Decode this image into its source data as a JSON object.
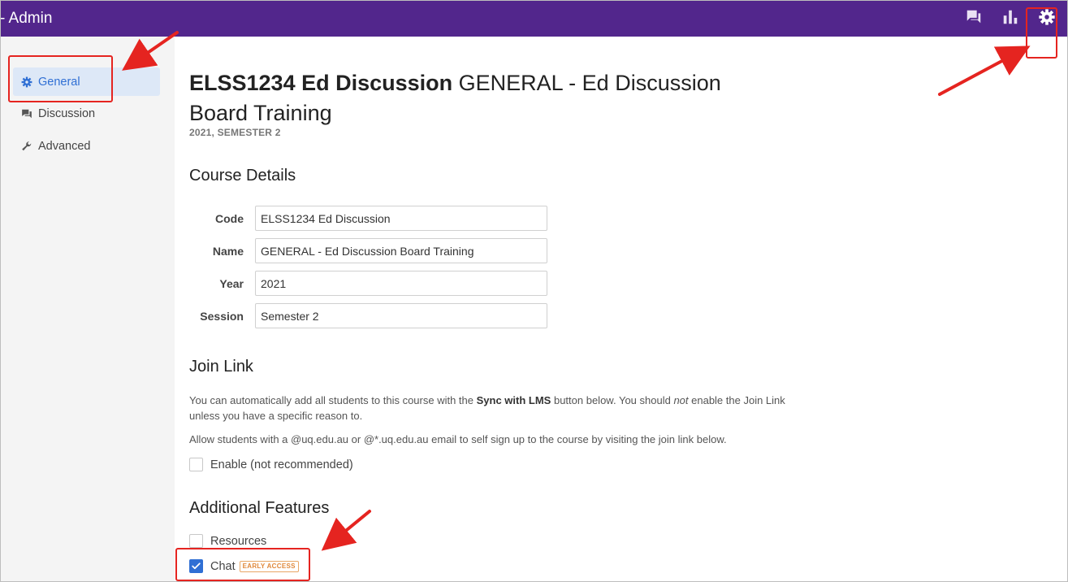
{
  "header": {
    "title": "- Admin",
    "icons": [
      "chat-icon",
      "bar-chart-icon",
      "gear-icon"
    ],
    "bg_color": "#52268c"
  },
  "sidebar": {
    "items": [
      {
        "label": "General",
        "icon": "gear-icon",
        "active": true
      },
      {
        "label": "Discussion",
        "icon": "chat-icon",
        "active": false
      },
      {
        "label": "Advanced",
        "icon": "wrench-icon",
        "active": false
      }
    ]
  },
  "course": {
    "code_bold": "ELSS1234 Ed Discussion",
    "name_rest": " GENERAL - Ed Discussion Board Training",
    "subtitle": "2021, SEMESTER 2"
  },
  "course_details": {
    "heading": "Course Details",
    "fields": [
      {
        "label": "Code",
        "value": "ELSS1234 Ed Discussion"
      },
      {
        "label": "Name",
        "value": "GENERAL - Ed Discussion Board Training"
      },
      {
        "label": "Year",
        "value": "2021"
      },
      {
        "label": "Session",
        "value": "Semester 2"
      }
    ]
  },
  "join_link": {
    "heading": "Join Link",
    "para1_a": "You can automatically add all students to this course with the ",
    "para1_b": "Sync with LMS",
    "para1_c": " button below. You should ",
    "para1_d": "not",
    "para1_e": " enable the Join Link unless you have a specific reason to.",
    "para2": "Allow students with a @uq.edu.au or @*.uq.edu.au email to self sign up to the course by visiting the join link below.",
    "enable_label": "Enable (not recommended)",
    "enable_checked": false
  },
  "additional": {
    "heading": "Additional Features",
    "resources_label": "Resources",
    "resources_checked": false,
    "chat_label": "Chat",
    "chat_checked": true,
    "chat_badge": "EARLY ACCESS"
  },
  "colors": {
    "accent": "#2f6fd4",
    "annotation": "#e52420"
  }
}
